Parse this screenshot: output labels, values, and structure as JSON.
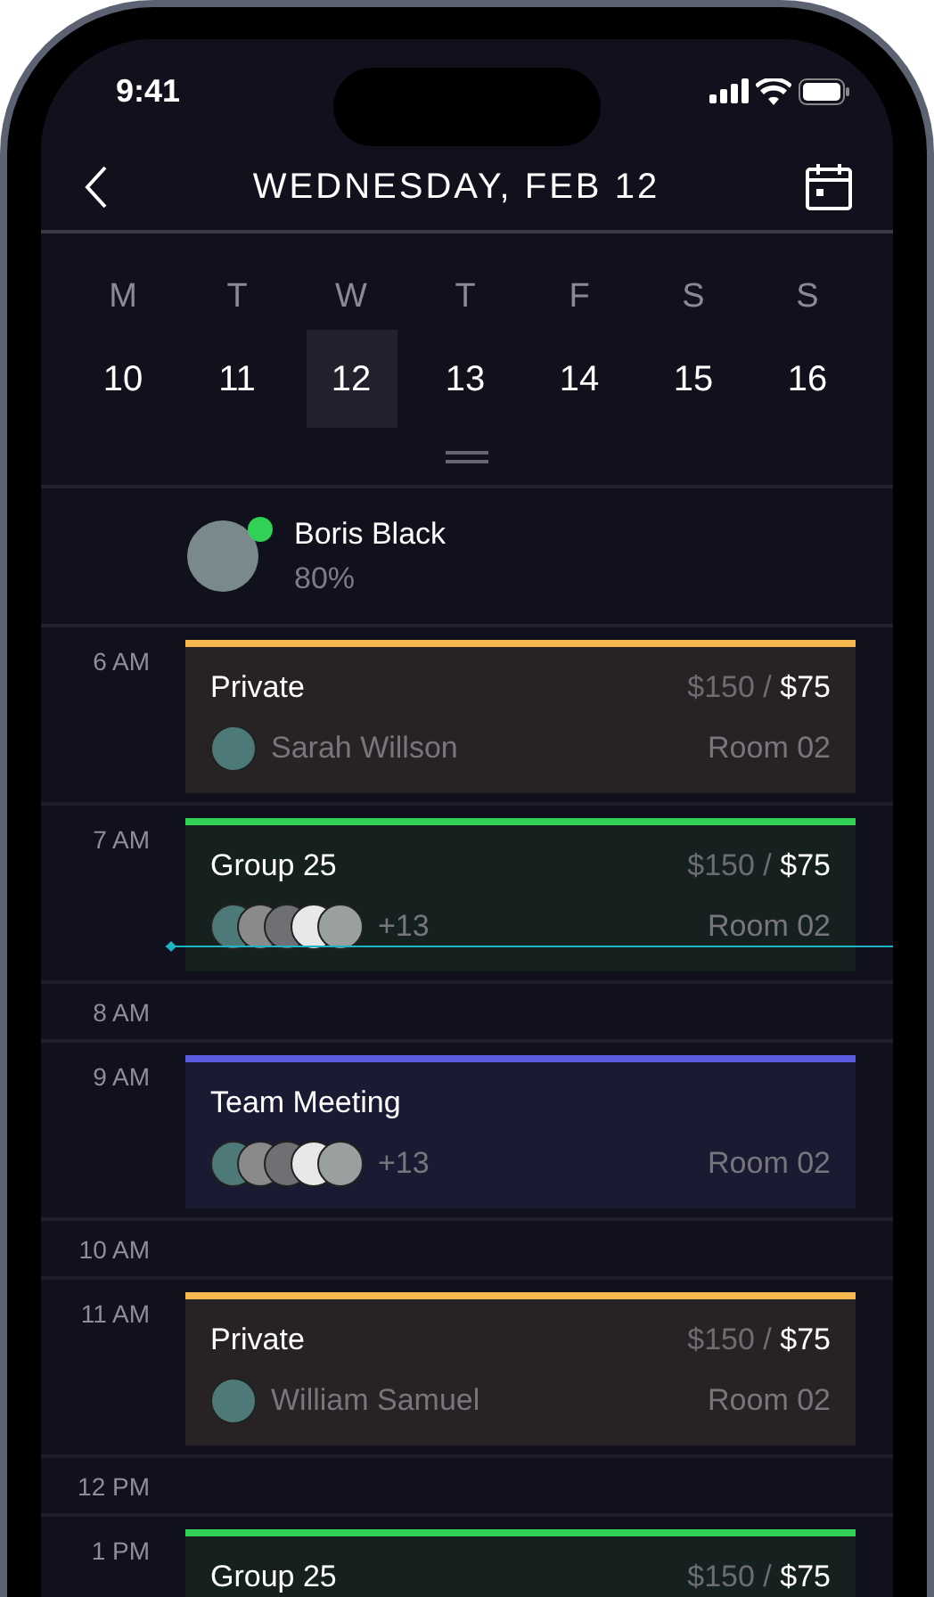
{
  "status_bar": {
    "time": "9:41"
  },
  "header": {
    "title": "WEDNESDAY, FEB 12"
  },
  "week": [
    {
      "letter": "M",
      "date": "10",
      "selected": false
    },
    {
      "letter": "T",
      "date": "11",
      "selected": false
    },
    {
      "letter": "W",
      "date": "12",
      "selected": true
    },
    {
      "letter": "T",
      "date": "13",
      "selected": false
    },
    {
      "letter": "F",
      "date": "14",
      "selected": false
    },
    {
      "letter": "S",
      "date": "15",
      "selected": false
    },
    {
      "letter": "S",
      "date": "16",
      "selected": false
    }
  ],
  "profile": {
    "name": "Boris Black",
    "percent": "80%",
    "online": true
  },
  "slots": [
    {
      "time": "6 AM",
      "events": [
        {
          "kind": "private",
          "color": "#f5b84f",
          "title": "Private",
          "price_old": "$150 /",
          "price": "$75",
          "attendee": "Sarah Willson",
          "room": "Room 02"
        }
      ]
    },
    {
      "time": "7 AM",
      "now": true,
      "events": [
        {
          "kind": "group",
          "color": "#31d158",
          "title": "Group 25",
          "price_old": "$150 /",
          "price": "$75",
          "extra": "+13",
          "room": "Room 02"
        }
      ]
    },
    {
      "time": "8 AM"
    },
    {
      "time": "9 AM",
      "events": [
        {
          "kind": "meeting",
          "color": "#5b5ce0",
          "title": "Team Meeting",
          "extra": "+13",
          "room": "Room 02"
        }
      ]
    },
    {
      "time": "10 AM"
    },
    {
      "time": "11 AM",
      "events": [
        {
          "kind": "private",
          "color": "#f5b84f",
          "title": "Private",
          "price_old": "$150 /",
          "price": "$75",
          "attendee": "William Samuel",
          "room": "Room 02"
        }
      ]
    },
    {
      "time": "12 PM"
    },
    {
      "time": "1 PM",
      "events": [
        {
          "kind": "group",
          "color": "#31d158",
          "title": "Group 25",
          "price_old": "$150 /",
          "price": "$75"
        }
      ]
    }
  ]
}
